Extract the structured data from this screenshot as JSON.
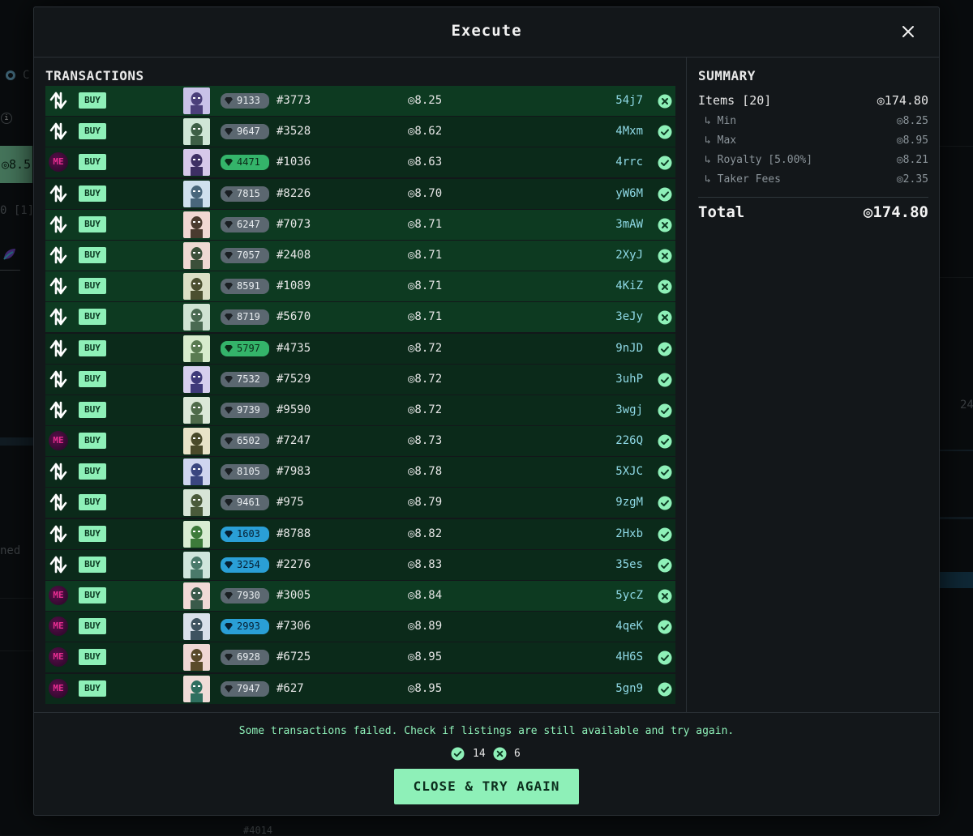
{
  "background": {
    "fragments": [
      "C",
      "◎8.5",
      "0 [1]",
      "ned",
      "24",
      "#4014"
    ]
  },
  "modal": {
    "title": "Execute",
    "close_icon": "close-icon"
  },
  "transactions": {
    "heading": "TRANSACTIONS",
    "buy_label": "BUY",
    "rows": [
      {
        "market": "tensor",
        "rank": "9133",
        "rank_color": "gray",
        "token": "#3773",
        "price": "◎8.25",
        "sig": "54j7",
        "status": "failed"
      },
      {
        "market": "tensor",
        "rank": "9647",
        "rank_color": "gray",
        "token": "#3528",
        "price": "◎8.62",
        "sig": "4Mxm",
        "status": "success"
      },
      {
        "market": "magiceden",
        "rank": "4471",
        "rank_color": "green",
        "token": "#1036",
        "price": "◎8.63",
        "sig": "4rrc",
        "status": "success"
      },
      {
        "market": "tensor",
        "rank": "7815",
        "rank_color": "gray",
        "token": "#8226",
        "price": "◎8.70",
        "sig": "yW6M",
        "status": "success"
      },
      {
        "market": "tensor",
        "rank": "6247",
        "rank_color": "gray",
        "token": "#7073",
        "price": "◎8.71",
        "sig": "3mAW",
        "status": "failed"
      },
      {
        "market": "tensor",
        "rank": "7057",
        "rank_color": "gray",
        "token": "#2408",
        "price": "◎8.71",
        "sig": "2XyJ",
        "status": "failed"
      },
      {
        "market": "tensor",
        "rank": "8591",
        "rank_color": "gray",
        "token": "#1089",
        "price": "◎8.71",
        "sig": "4KiZ",
        "status": "failed"
      },
      {
        "market": "tensor",
        "rank": "8719",
        "rank_color": "gray",
        "token": "#5670",
        "price": "◎8.71",
        "sig": "3eJy",
        "status": "failed"
      },
      {
        "market": "tensor",
        "rank": "5797",
        "rank_color": "green",
        "token": "#4735",
        "price": "◎8.72",
        "sig": "9nJD",
        "status": "success"
      },
      {
        "market": "tensor",
        "rank": "7532",
        "rank_color": "gray",
        "token": "#7529",
        "price": "◎8.72",
        "sig": "3uhP",
        "status": "success"
      },
      {
        "market": "tensor",
        "rank": "9739",
        "rank_color": "gray",
        "token": "#9590",
        "price": "◎8.72",
        "sig": "3wgj",
        "status": "success"
      },
      {
        "market": "magiceden",
        "rank": "6502",
        "rank_color": "gray",
        "token": "#7247",
        "price": "◎8.73",
        "sig": "226Q",
        "status": "success"
      },
      {
        "market": "tensor",
        "rank": "8105",
        "rank_color": "gray",
        "token": "#7983",
        "price": "◎8.78",
        "sig": "5XJC",
        "status": "success"
      },
      {
        "market": "tensor",
        "rank": "9461",
        "rank_color": "gray",
        "token": "#975",
        "price": "◎8.79",
        "sig": "9zgM",
        "status": "success"
      },
      {
        "market": "tensor",
        "rank": "1603",
        "rank_color": "blue",
        "token": "#8788",
        "price": "◎8.82",
        "sig": "2Hxb",
        "status": "success"
      },
      {
        "market": "tensor",
        "rank": "3254",
        "rank_color": "blue",
        "token": "#2276",
        "price": "◎8.83",
        "sig": "35es",
        "status": "success"
      },
      {
        "market": "magiceden",
        "rank": "7930",
        "rank_color": "gray",
        "token": "#3005",
        "price": "◎8.84",
        "sig": "5ycZ",
        "status": "failed"
      },
      {
        "market": "magiceden",
        "rank": "2993",
        "rank_color": "blue",
        "token": "#7306",
        "price": "◎8.89",
        "sig": "4qeK",
        "status": "success"
      },
      {
        "market": "magiceden",
        "rank": "6928",
        "rank_color": "gray",
        "token": "#6725",
        "price": "◎8.95",
        "sig": "4H6S",
        "status": "success"
      },
      {
        "market": "magiceden",
        "rank": "7947",
        "rank_color": "gray",
        "token": "#627",
        "price": "◎8.95",
        "sig": "5gn9",
        "status": "success"
      }
    ]
  },
  "summary": {
    "heading": "SUMMARY",
    "items_label": "Items [20]",
    "items_value": "◎174.80",
    "min_label": "↳ Min",
    "min_value": "◎8.25",
    "max_label": "↳ Max",
    "max_value": "◎8.95",
    "royalty_label": "↳ Royalty [5.00%]",
    "royalty_value": "◎8.21",
    "fees_label": "↳ Taker Fees",
    "fees_value": "◎2.35",
    "total_label": "Total",
    "total_value": "◎174.80"
  },
  "footer": {
    "notice": "Some transactions failed. Check if listings are still available and try again.",
    "success_count": "14",
    "failed_count": "6",
    "button_label": "CLOSE & TRY AGAIN"
  },
  "colors": {
    "accent": "#8ef0b8",
    "row_bg": "#0d3a21",
    "rank_gray": "#5b6770",
    "rank_green": "#34b46a",
    "rank_blue": "#2a9fd6",
    "signature": "#8fd9e6"
  }
}
